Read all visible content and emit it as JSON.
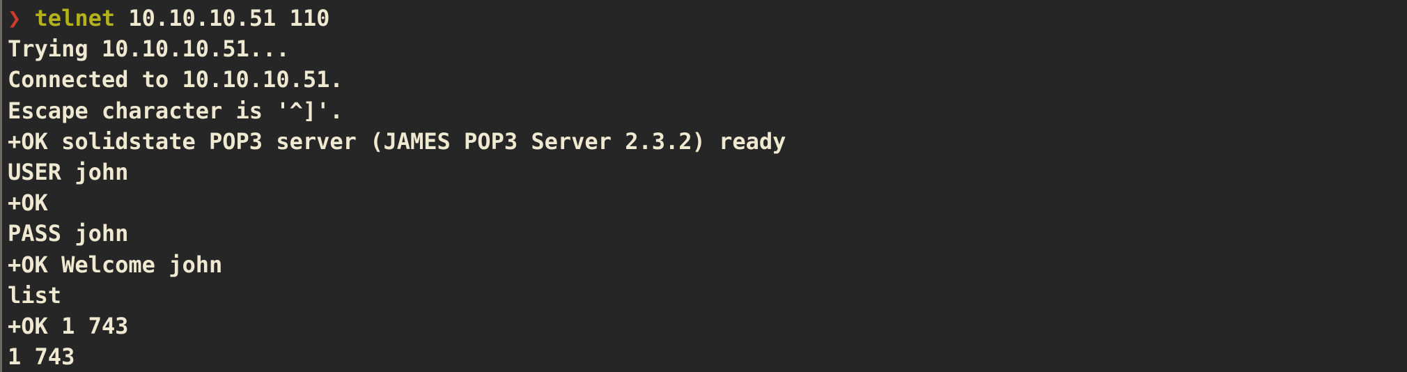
{
  "prompt": {
    "symbol": "❯",
    "command": "telnet",
    "args": "10.10.10.51 110"
  },
  "output": [
    "Trying 10.10.10.51...",
    "Connected to 10.10.10.51.",
    "Escape character is '^]'.",
    "+OK solidstate POP3 server (JAMES POP3 Server 2.3.2) ready",
    "USER john",
    "+OK",
    "PASS john",
    "+OK Welcome john",
    "list",
    "+OK 1 743",
    "1 743"
  ],
  "colors": {
    "background": "#262626",
    "text": "#f0e9d2",
    "prompt_symbol": "#cf3b2e",
    "command": "#b4b21c"
  }
}
